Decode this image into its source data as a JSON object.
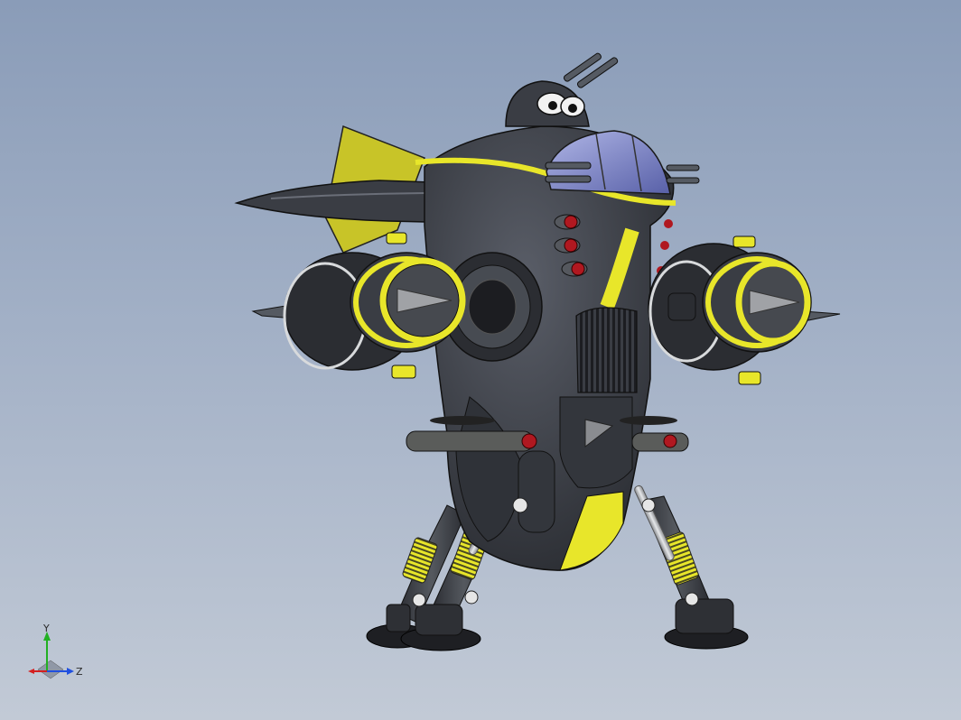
{
  "viewport": {
    "background_top": "#8a9cb8",
    "background_bottom": "#c2cad6"
  },
  "model": {
    "body_color": "#3a3d44",
    "accent_color": "#e8e62a",
    "canopy_color": "#7d84c4",
    "light_color": "#b01820"
  },
  "triad": {
    "y_label": "Y",
    "z_label": "Z",
    "x_color": "#d42020",
    "y_color": "#22b022",
    "z_color": "#2050e0"
  }
}
